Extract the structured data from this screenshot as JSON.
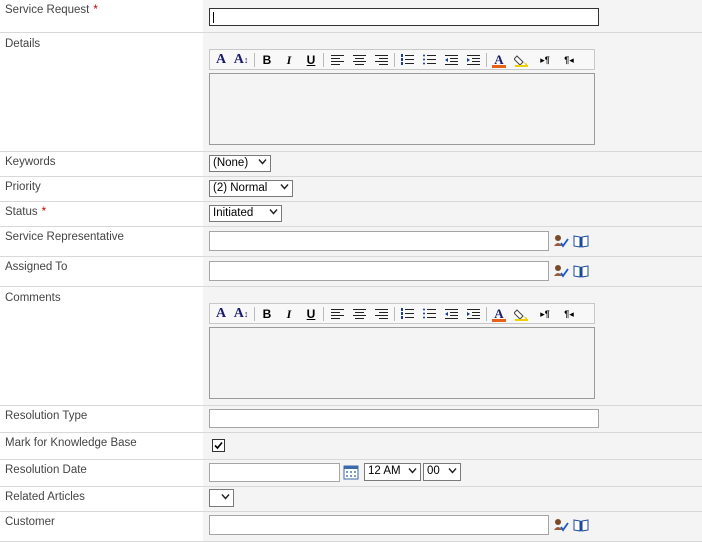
{
  "fields": {
    "service_request": {
      "label": "Service Request",
      "required_mark": "*",
      "value": ""
    },
    "details": {
      "label": "Details"
    },
    "keywords": {
      "label": "Keywords",
      "value": "(None)"
    },
    "priority": {
      "label": "Priority",
      "value": "(2) Normal"
    },
    "status": {
      "label": "Status",
      "required_mark": "*",
      "value": "Initiated"
    },
    "service_representative": {
      "label": "Service Representative",
      "value": ""
    },
    "assigned_to": {
      "label": "Assigned To",
      "value": ""
    },
    "comments": {
      "label": "Comments"
    },
    "resolution_type": {
      "label": "Resolution Type",
      "value": ""
    },
    "mark_for_kb": {
      "label": "Mark for Knowledge Base",
      "checked": true
    },
    "resolution_date": {
      "label": "Resolution Date",
      "date": "",
      "hour": "12 AM",
      "minute": "00"
    },
    "related_articles": {
      "label": "Related Articles",
      "value": ""
    },
    "customer": {
      "label": "Customer",
      "value": ""
    }
  },
  "rte_toolbar": {
    "font": "A",
    "font_size": "A",
    "font_size_sub": "↕",
    "bold": "B",
    "italic": "I",
    "underline": "U",
    "ltr": "▸¶",
    "rtl": "¶◂",
    "font_color_swatch": "#e8611a"
  },
  "icons": [
    "check-names-icon",
    "browse-address-book-icon",
    "calendar-icon",
    "dropdown-arrow-icon"
  ]
}
